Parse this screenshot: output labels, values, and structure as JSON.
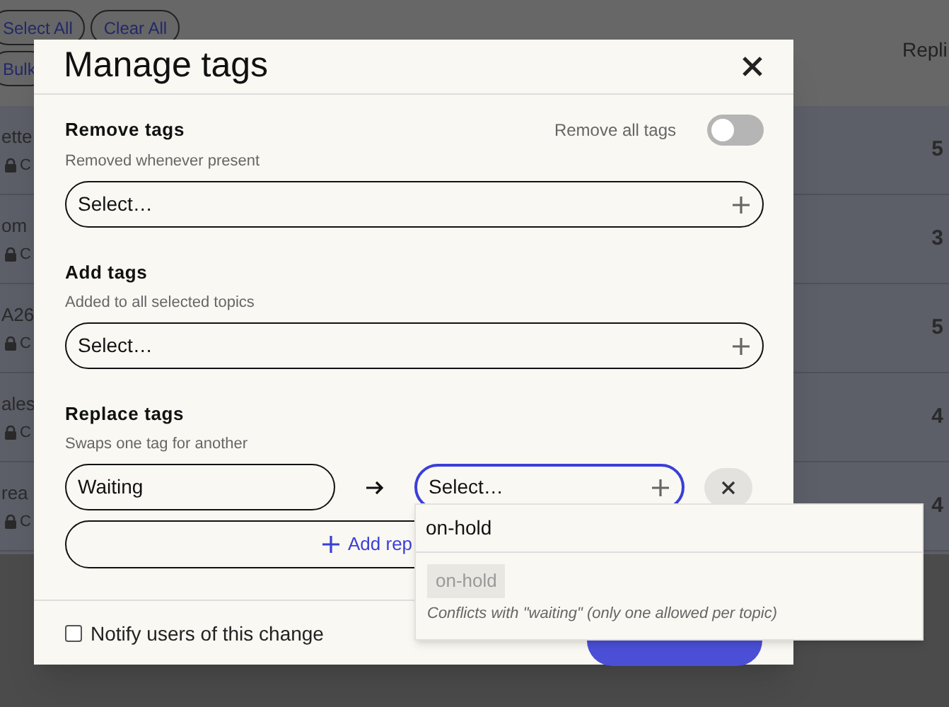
{
  "background": {
    "buttons": [
      {
        "label": "Select All"
      },
      {
        "label": "Clear All"
      },
      {
        "label": "Bulk"
      }
    ],
    "column_header": "Repli",
    "rows": [
      {
        "title": "ette",
        "meta": "C",
        "replies": "5"
      },
      {
        "title": "om",
        "meta": "C",
        "replies": "3"
      },
      {
        "title": "A26",
        "meta": "C",
        "replies": "5"
      },
      {
        "title": "ales",
        "meta": "C",
        "replies": "4"
      },
      {
        "title": "rea",
        "meta": "C",
        "replies": "4"
      }
    ]
  },
  "dialog": {
    "title": "Manage tags",
    "sections": [
      {
        "kind": "select",
        "title": "Remove tags",
        "hint": "Removed whenever present",
        "toggle": {
          "label": "Remove all tags",
          "on": false
        },
        "placeholder": "Select…"
      },
      {
        "kind": "select",
        "title": "Add tags",
        "hint": "Added to all selected topics",
        "placeholder": "Select…"
      },
      {
        "kind": "replace",
        "title": "Replace tags",
        "hint": "Swaps one tag for another",
        "from": "Waiting",
        "to_placeholder": "Select…",
        "add_label": "Add rep"
      }
    ],
    "notify": {
      "label": "Notify users of this change",
      "checked": false
    }
  },
  "dropdown": {
    "query": "on-hold",
    "options": [
      {
        "tag": "on-hold",
        "note": "Conflicts with \"waiting\" (only one allowed per topic)",
        "disabled": true
      }
    ]
  }
}
